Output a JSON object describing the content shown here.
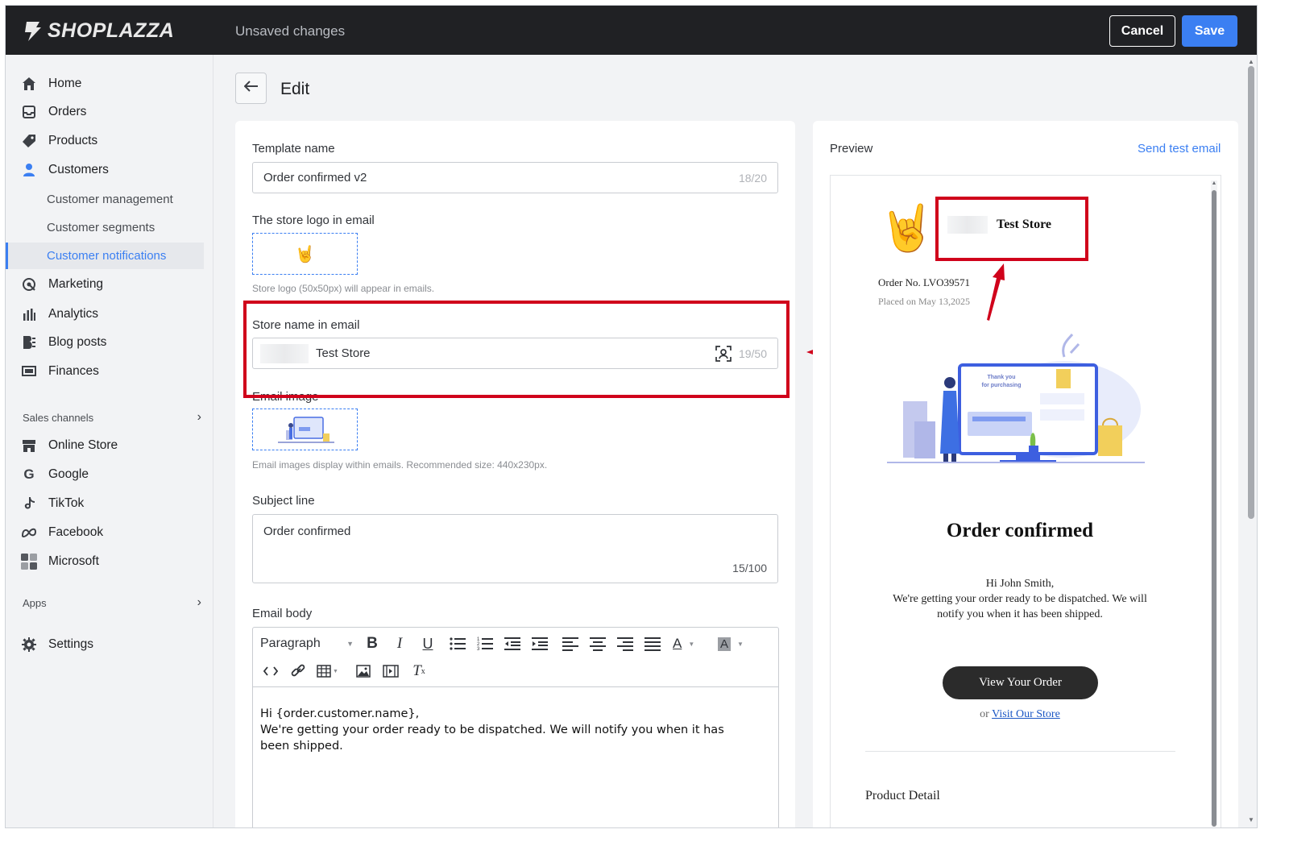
{
  "topbar": {
    "logo_text": "SHOPLAZZA",
    "status": "Unsaved changes",
    "cancel_label": "Cancel",
    "save_label": "Save"
  },
  "sidebar": {
    "items": [
      {
        "label": "Home",
        "icon": "home-icon"
      },
      {
        "label": "Orders",
        "icon": "inbox-icon"
      },
      {
        "label": "Products",
        "icon": "tag-icon"
      },
      {
        "label": "Customers",
        "icon": "user-icon"
      }
    ],
    "sub_items": [
      {
        "label": "Customer management"
      },
      {
        "label": "Customer segments"
      },
      {
        "label": "Customer notifications",
        "active": true
      }
    ],
    "items2": [
      {
        "label": "Marketing",
        "icon": "marketing-icon"
      },
      {
        "label": "Analytics",
        "icon": "analytics-icon"
      },
      {
        "label": "Blog posts",
        "icon": "blog-icon"
      },
      {
        "label": "Finances",
        "icon": "finances-icon"
      }
    ],
    "sales_channels_label": "Sales channels",
    "channels": [
      {
        "label": "Online Store",
        "icon": "store-icon"
      },
      {
        "label": "Google",
        "icon": "google-icon"
      },
      {
        "label": "TikTok",
        "icon": "tiktok-icon"
      },
      {
        "label": "Facebook",
        "icon": "meta-icon"
      },
      {
        "label": "Microsoft",
        "icon": "microsoft-icon"
      }
    ],
    "apps_label": "Apps",
    "settings_label": "Settings"
  },
  "edit": {
    "title": "Edit",
    "template_name_label": "Template name",
    "template_name_value": "Order confirmed v2",
    "template_name_counter": "18/20",
    "logo_label": "The store logo in email",
    "logo_help": "Store logo (50x50px) will appear in emails.",
    "store_name_label": "Store name in email",
    "store_name_value": "Test Store",
    "store_name_counter": "19/50",
    "email_image_label": "Email image",
    "email_image_help": "Email images display within emails. Recommended size: 440x230px.",
    "subject_label": "Subject line",
    "subject_value": "Order confirmed",
    "subject_counter": "15/100",
    "body_label": "Email body",
    "paragraph_select": "Paragraph",
    "body_line1": "Hi {order.customer.name},",
    "body_line2": "We're getting your order ready to be dispatched. We will notify you when it has",
    "body_line3": "been shipped."
  },
  "preview": {
    "label": "Preview",
    "send_test": "Send test email",
    "store_name": "Test Store",
    "order_no": "Order No. LVO39571",
    "placed_on": "Placed on May 13,2025",
    "illustration_text1": "Thank you",
    "illustration_text2": "for purchasing",
    "heading": "Order confirmed",
    "greeting": "Hi John Smith,",
    "message1": "We're getting your order ready to be dispatched. We will",
    "message2": "notify you when it has been shipped.",
    "view_order": "View Your Order",
    "or_text": "or",
    "visit_store": "Visit Our Store",
    "product_detail": "Product Detail"
  },
  "colors": {
    "accent": "#3b7ff2",
    "topbar": "#202124",
    "highlight": "#d0021b"
  }
}
